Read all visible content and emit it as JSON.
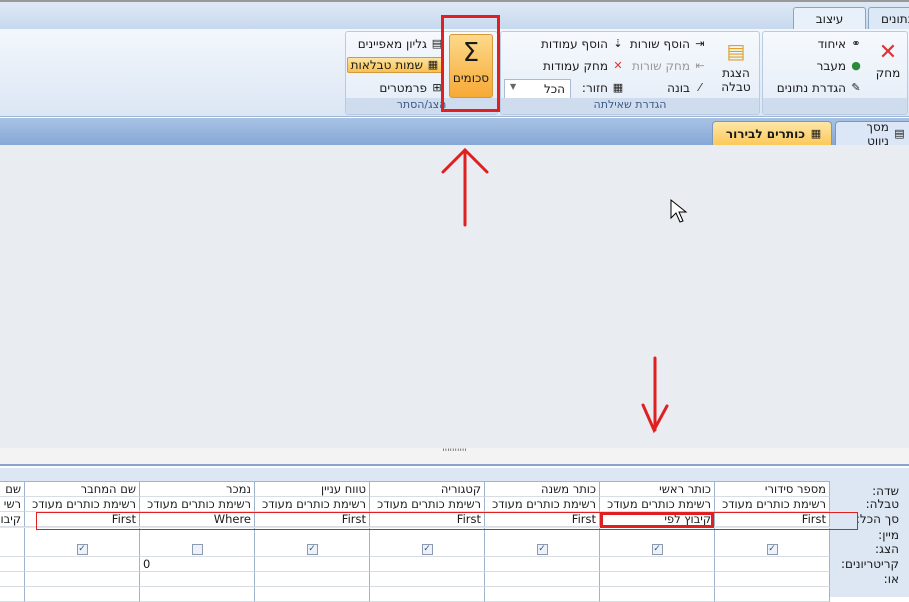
{
  "ribbon_tabs": [
    {
      "label": "עיצוב",
      "active": true
    },
    {
      "label": "נתונים",
      "active": false
    }
  ],
  "groups": {
    "results": {
      "delete": "מחק",
      "union": "איחוד",
      "pass_through": "מעבר",
      "data_definition": "הגדרת נתונים"
    },
    "query_setup": {
      "label": "הגדרת שאילתה",
      "show_table": "הצגת טבלה",
      "insert_rows": "הוסף שורות",
      "delete_rows": "מחק שורות",
      "builder": "בונה",
      "insert_columns": "הוסף עמודות",
      "delete_columns": "מחק עמודות",
      "return_label": "חזור:",
      "return_value": "הכל"
    },
    "show_hide": {
      "label": "הצג/הסתר",
      "totals": "סכומים",
      "property_sheet": "גליון מאפיינים",
      "table_names": "שמות טבלאות",
      "parameters": "פרמטרים"
    }
  },
  "doc_tabs": [
    {
      "label": "מסך ניווט",
      "active": false
    },
    {
      "label": "כותרים לבירור",
      "active": true
    }
  ],
  "splitter_dots": "''''''''''",
  "row_labels": [
    "שדה:",
    "טבלה:",
    "סך הכל:",
    "מיין:",
    "הצג:",
    "קריטריונים:",
    "או:"
  ],
  "columns": [
    {
      "field": "מספר סידורי",
      "table": "רשימת כותרים מעודכ",
      "total": "First",
      "show": true,
      "criteria": ""
    },
    {
      "field": "כותר ראשי",
      "table": "רשימת כותרים מעודכ",
      "total": "קיבוץ לפי",
      "show": true,
      "criteria": ""
    },
    {
      "field": "כותר משנה",
      "table": "רשימת כותרים מעודכ",
      "total": "First",
      "show": true,
      "criteria": ""
    },
    {
      "field": "קטגוריה",
      "table": "רשימת כותרים מעודכ",
      "total": "First",
      "show": true,
      "criteria": ""
    },
    {
      "field": "טווח עניין",
      "table": "רשימת כותרים מעודכ",
      "total": "First",
      "show": true,
      "criteria": ""
    },
    {
      "field": "נמכר",
      "table": "רשימת כותרים מעודכ",
      "total": "Where",
      "show": false,
      "criteria": "0"
    },
    {
      "field": "שם המחבר",
      "table": "רשימת כותרים מעודכ",
      "total": "First",
      "show": true,
      "criteria": ""
    },
    {
      "field": "שם",
      "table": "רשי",
      "total": "קיבו",
      "show": null,
      "criteria": ""
    }
  ],
  "colors": {
    "annotation": "#e02020",
    "active_doc_tab": "#fcd36e",
    "totals_button": "#f9b748"
  }
}
